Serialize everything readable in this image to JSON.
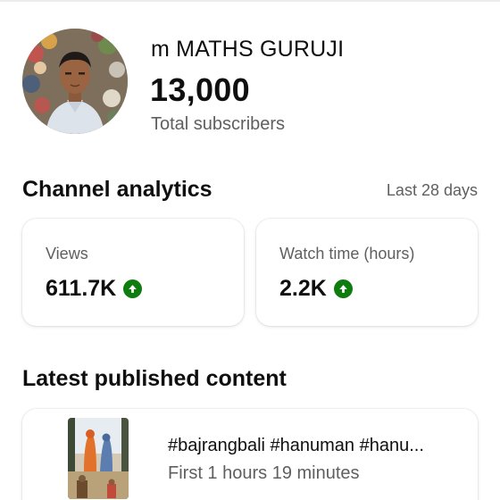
{
  "channel": {
    "name": "m MATHS GURUJI",
    "subscriber_count": "13,000",
    "subscriber_label": "Total subscribers"
  },
  "analytics": {
    "title": "Channel analytics",
    "range": "Last 28 days",
    "metrics": [
      {
        "label": "Views",
        "value": "611.7K",
        "trend": "up",
        "trend_icon": "arrow-up-circle-icon"
      },
      {
        "label": "Watch time (hours)",
        "value": "2.2K",
        "trend": "up",
        "trend_icon": "arrow-up-circle-icon"
      }
    ]
  },
  "latest": {
    "title": "Latest published content",
    "video": {
      "title": "#bajrangbali #hanuman #hanu...",
      "stat": "First 1 hours 19 minutes"
    }
  },
  "colors": {
    "trend_up": "#107c10",
    "text_primary": "#0f0f0f",
    "text_secondary": "#5f5f5f"
  }
}
